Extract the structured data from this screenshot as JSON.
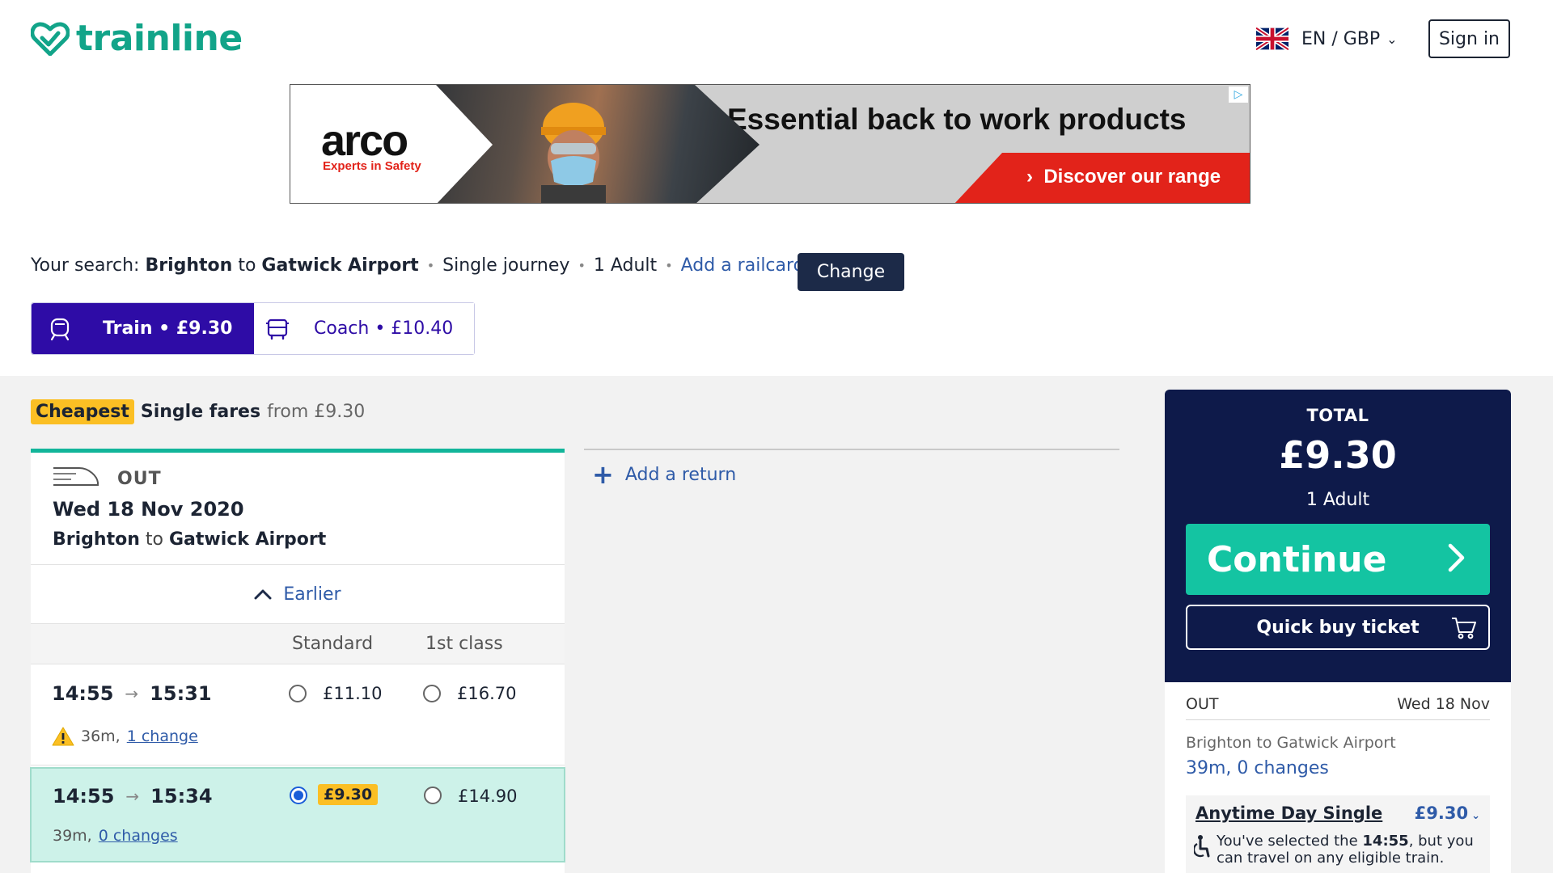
{
  "header": {
    "logo_text": "trainline",
    "locale": "EN / GBP",
    "sign_in": "Sign in"
  },
  "ad": {
    "brand": "arco",
    "tagline": "Experts in Safety",
    "headline": "Essential back to work products",
    "cta": "Discover our range"
  },
  "search": {
    "prefix": "Your search:",
    "origin": "Brighton",
    "to": "to",
    "destination": "Gatwick Airport",
    "journey_type": "Single journey",
    "passengers": "1 Adult",
    "railcard": "Add a railcard",
    "change": "Change"
  },
  "modes": [
    {
      "label": "Train • £9.30",
      "active": true,
      "icon": "train-icon"
    },
    {
      "label": "Coach • £10.40",
      "active": false,
      "icon": "coach-icon"
    }
  ],
  "fares_heading": {
    "badge": "Cheapest",
    "label": "Single fares",
    "from": "from £9.30"
  },
  "outbound": {
    "label": "OUT",
    "date": "Wed 18 Nov 2020",
    "origin": "Brighton",
    "to": "to",
    "destination": "Gatwick Airport",
    "earlier": "Earlier",
    "col_standard": "Standard",
    "col_first": "1st class",
    "journeys": [
      {
        "depart": "14:55",
        "arrive": "15:31",
        "duration": "36m,",
        "changes": "1 change",
        "standard": "£11.10",
        "first": "£16.70",
        "selected": false,
        "warning": true
      },
      {
        "depart": "14:55",
        "arrive": "15:34",
        "duration": "39m,",
        "changes": "0 changes",
        "standard": "£9.30",
        "first": "£14.90",
        "selected": true,
        "warning": false
      }
    ]
  },
  "return": {
    "add_return": "Add a return"
  },
  "total": {
    "label": "TOTAL",
    "amount": "£9.30",
    "passengers": "1 Adult",
    "continue": "Continue",
    "quick_buy": "Quick buy ticket"
  },
  "summary": {
    "direction": "OUT",
    "date": "Wed 18 Nov",
    "route": "Brighton to Gatwick Airport",
    "duration": "39m, 0 changes",
    "fare_name": "Anytime Day Single",
    "fare_price": "£9.30",
    "note_before": "You've selected the ",
    "note_time": "14:55",
    "note_after": ", but you can travel on any eligible train."
  },
  "colors": {
    "brand": "#12a489",
    "train_tab": "#2e0ca6",
    "total_panel": "#0e1a4a",
    "continue": "#14c4a2",
    "selected_row": "#cdf2e9",
    "badge": "#fbbf24"
  }
}
